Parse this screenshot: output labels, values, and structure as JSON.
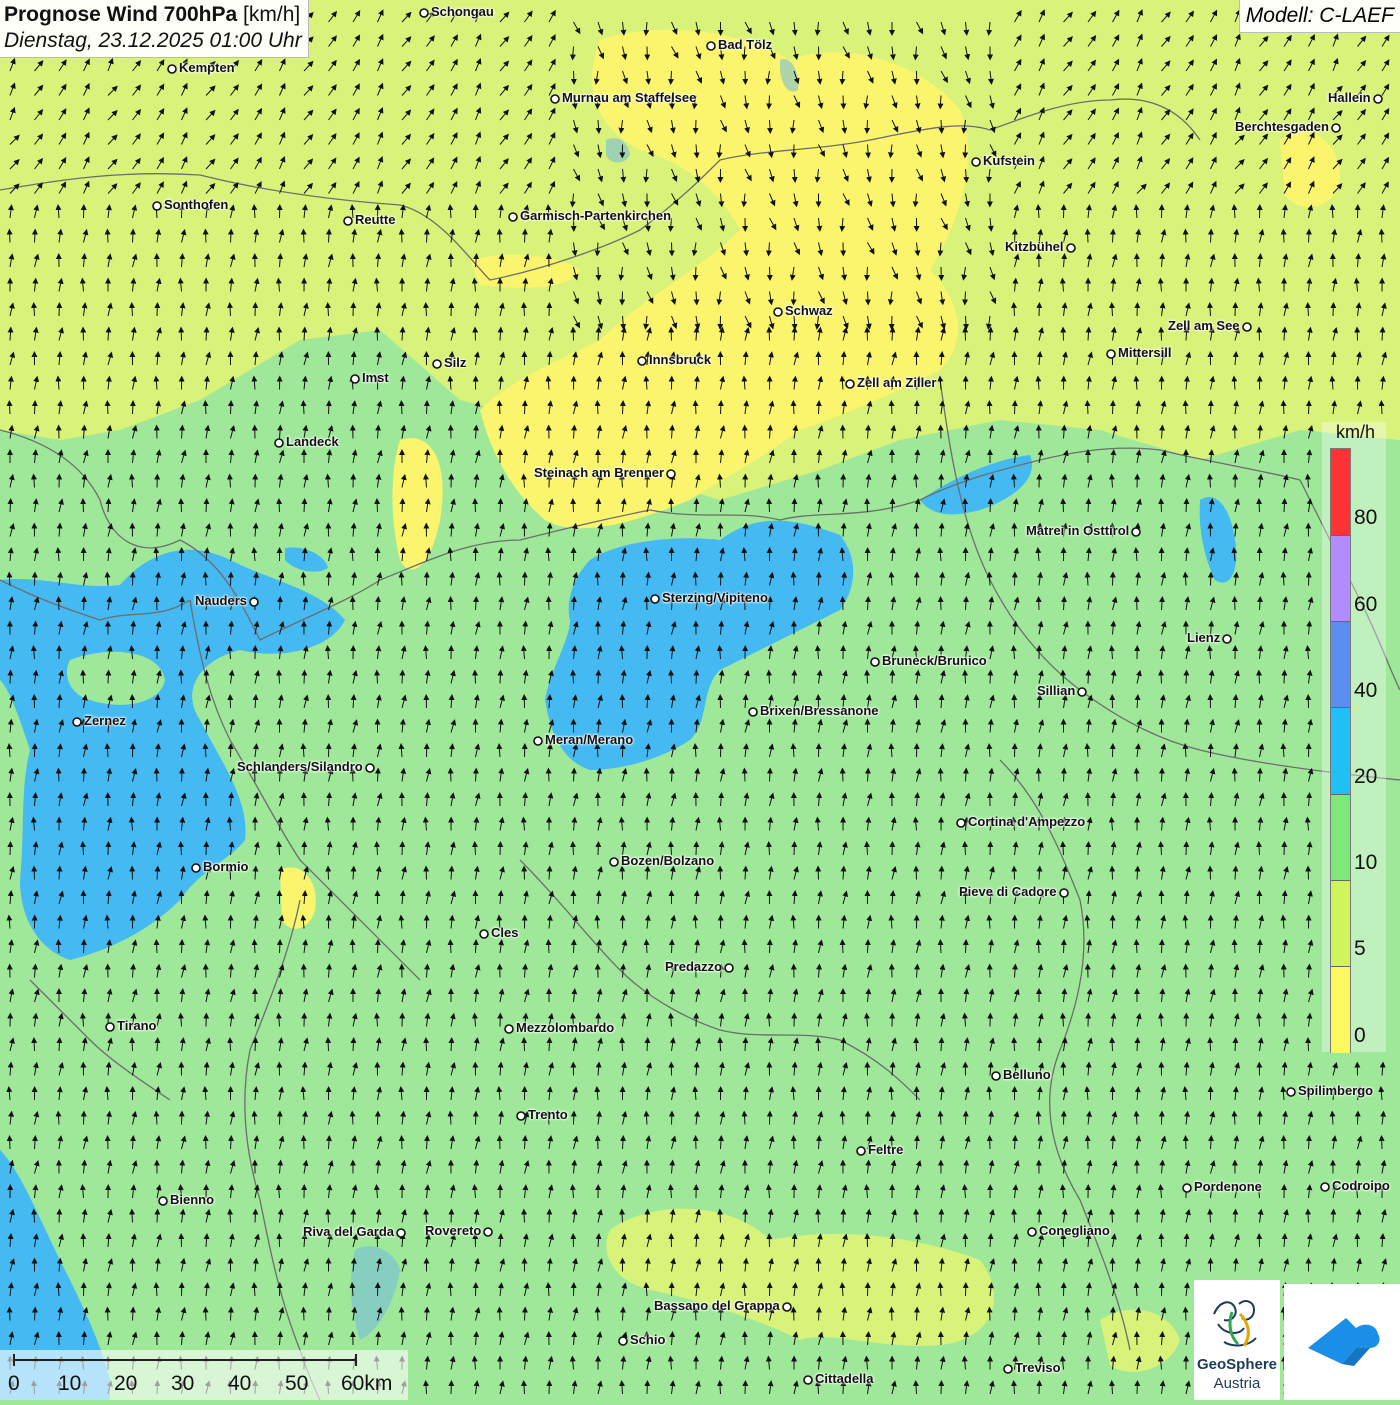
{
  "header": {
    "title_bold": "Prognose Wind 700hPa",
    "title_unit": "[km/h]",
    "datetime": "Dienstag, 23.12.2025 01:00 Uhr"
  },
  "model": "Modell: C-LAEF",
  "legend": {
    "unit": "km/h",
    "ticks": [
      "80",
      "60",
      "40",
      "20",
      "10",
      "5",
      "0"
    ],
    "colors": [
      "#ff3333",
      "#b08cff",
      "#8a5cf5",
      "#5a8ef0",
      "#1ec0f5",
      "#7fe87a",
      "#cff55a",
      "#fbf860"
    ]
  },
  "colors": {
    "land_green": "#9fe89a",
    "yellow_green": "#d9f27a",
    "yellow": "#fbf56e",
    "blue": "#45b9f2",
    "border": "#6d6d6d"
  },
  "cities": [
    {
      "name": "Schongau"
    },
    {
      "name": "Bad Tölz"
    },
    {
      "name": "Kempten"
    },
    {
      "name": "Murnau am Staffelsee"
    },
    {
      "name": "Hallein"
    },
    {
      "name": "Berchtesgaden"
    },
    {
      "name": "Kufstein"
    },
    {
      "name": "Sonthofen"
    },
    {
      "name": "Reutte"
    },
    {
      "name": "Garmisch-Partenkirchen"
    },
    {
      "name": "Kitzbühel"
    },
    {
      "name": "Schwaz"
    },
    {
      "name": "Zell am See"
    },
    {
      "name": "Mittersill"
    },
    {
      "name": "Innsbruck"
    },
    {
      "name": "Imst"
    },
    {
      "name": "Silz"
    },
    {
      "name": "Zell am Ziller"
    },
    {
      "name": "Landeck"
    },
    {
      "name": "Steinach am Brenner"
    },
    {
      "name": "Matrei in Osttirol"
    },
    {
      "name": "Nauders"
    },
    {
      "name": "Sterzing/Vipiteno"
    },
    {
      "name": "Lienz"
    },
    {
      "name": "Bruneck/Brunico"
    },
    {
      "name": "Sillian"
    },
    {
      "name": "Zernez"
    },
    {
      "name": "Brixen/Bressanone"
    },
    {
      "name": "Meran/Merano"
    },
    {
      "name": "Schlanders/Silandro"
    },
    {
      "name": "Cortina d'Ampezzo"
    },
    {
      "name": "Bozen/Bolzano"
    },
    {
      "name": "Bormio"
    },
    {
      "name": "Pieve di Cadore"
    },
    {
      "name": "Cles"
    },
    {
      "name": "Predazzo"
    },
    {
      "name": "Tirano"
    },
    {
      "name": "Mezzolombardo"
    },
    {
      "name": "Belluno"
    },
    {
      "name": "Spilimbergo"
    },
    {
      "name": "Trento"
    },
    {
      "name": "Feltre"
    },
    {
      "name": "Pordenone"
    },
    {
      "name": "Codroipo"
    },
    {
      "name": "Bienno"
    },
    {
      "name": "Riva del Garda"
    },
    {
      "name": "Rovereto"
    },
    {
      "name": "Conegliano"
    },
    {
      "name": "Bassano del Grappa"
    },
    {
      "name": "Schio"
    },
    {
      "name": "Treviso"
    },
    {
      "name": "Cittadella"
    }
  ],
  "scale_bar": {
    "labels": [
      "0",
      "10",
      "20",
      "30",
      "40",
      "50",
      "60km"
    ]
  },
  "logos": {
    "geosphere_line1": "GeoSphere",
    "geosphere_line2": "Austria"
  }
}
